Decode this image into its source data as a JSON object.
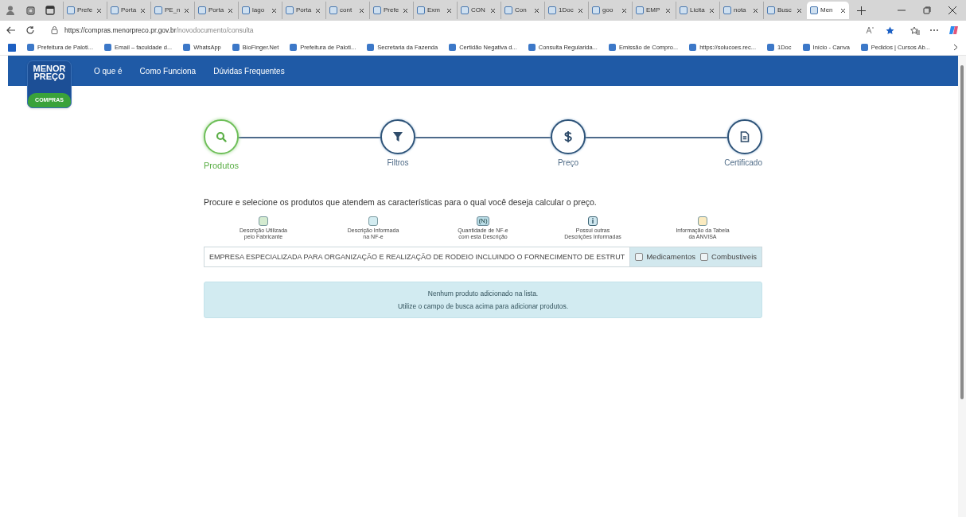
{
  "browser": {
    "tabs": [
      {
        "label": "Prefe",
        "selected": false
      },
      {
        "label": "Porta",
        "selected": false
      },
      {
        "label": "PE_n",
        "selected": false
      },
      {
        "label": "Porta",
        "selected": false
      },
      {
        "label": "lago",
        "selected": false
      },
      {
        "label": "Porta",
        "selected": false
      },
      {
        "label": "cont",
        "selected": false
      },
      {
        "label": "Prefe",
        "selected": false
      },
      {
        "label": "Exm",
        "selected": false
      },
      {
        "label": "CON",
        "selected": false
      },
      {
        "label": "Con",
        "selected": false
      },
      {
        "label": "1Doc",
        "selected": false
      },
      {
        "label": "goo",
        "selected": false
      },
      {
        "label": "EMP",
        "selected": false
      },
      {
        "label": "Licita",
        "selected": false
      },
      {
        "label": "nota",
        "selected": false
      },
      {
        "label": "Busc",
        "selected": false
      },
      {
        "label": "Men",
        "selected": true
      }
    ],
    "url_host": "https://compras.menorpreco.pr.gov.br",
    "url_path": "/novodocumento/consulta",
    "bookmarks": [
      "Prefeitura de Paloti...",
      "Email – faculdade d...",
      "WhatsApp",
      "BioFinger.Net",
      "Prefeitura de Paloti...",
      "Secretaria da Fazenda",
      "Certidão Negativa d...",
      "Consulta Regularida...",
      "Emissão de Compro...",
      "https://solucoes.rec...",
      "1Doc",
      "Início - Canva",
      "Pedidos | Cursos Ab..."
    ]
  },
  "logo": {
    "line_1": "MENOR",
    "line_2": "PREÇO",
    "badge": "COMPRAS"
  },
  "nav": [
    "O que é",
    "Como Funciona",
    "Dúvidas Frequentes"
  ],
  "steps": [
    {
      "label": "Produtos",
      "kind": "search",
      "selected": true
    },
    {
      "label": "Filtros",
      "kind": "filter",
      "selected": false
    },
    {
      "label": "Preço",
      "kind": "price",
      "selected": false
    },
    {
      "label": "Certificado",
      "kind": "document",
      "selected": false
    }
  ],
  "instruction": "Procure e selecione os produtos que atendem as características para o qual você deseja calcular o preço.",
  "legend": [
    {
      "kind": "swatch",
      "color": "#d4ebd0",
      "lines": [
        "Descrição Utilizada",
        "pelo Fabricante"
      ]
    },
    {
      "kind": "swatch",
      "color": "#d3ecf1",
      "lines": [
        "Descrição Informada",
        "na NF-e"
      ]
    },
    {
      "kind": "count",
      "symbol": "(N)",
      "lines": [
        "Quantidade de NF-e",
        "com esta Descrição"
      ]
    },
    {
      "kind": "info",
      "symbol": "i",
      "lines": [
        "Possui outras",
        "Descrições Informadas"
      ]
    },
    {
      "kind": "swatch",
      "color": "#fbebc0",
      "lines": [
        "Informação da Tabela",
        "da ANVISA"
      ]
    }
  ],
  "search": {
    "value": "EMPRESA ESPECIALIZADA PARA ORGANIZAÇÃO E REALIZAÇÃO DE RODEIO INCLUINDO O FORNECIMENTO DE ESTRUT"
  },
  "filters": [
    {
      "label": "Medicamentos",
      "checked": false
    },
    {
      "label": "Combustiveis",
      "checked": false
    }
  ],
  "alert": [
    "Nenhum produto adicionado na lista.",
    "Utilize o campo de busca acima para adicionar produtos."
  ]
}
